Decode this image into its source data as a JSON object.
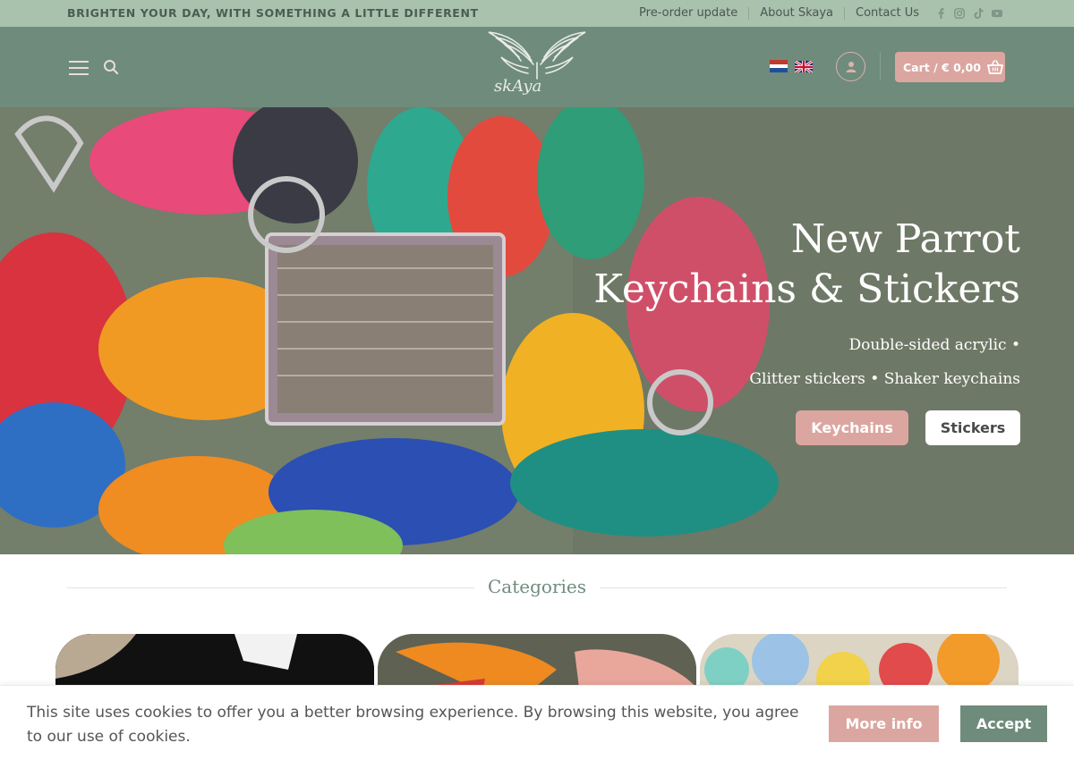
{
  "topbar": {
    "tagline": "BRIGHTEN YOUR DAY, WITH SOMETHING A LITTLE DIFFERENT",
    "links": [
      "Pre-order update",
      "About Skaya",
      "Contact Us"
    ],
    "social_icons": [
      "facebook-icon",
      "instagram-icon",
      "tiktok-icon",
      "youtube-icon"
    ]
  },
  "header": {
    "logo_text": "skAya",
    "languages": [
      "Dutch",
      "English"
    ],
    "cart_label": "Cart / € 0,00"
  },
  "hero": {
    "title_line1": "New Parrot",
    "title_line2": "Keychains & Stickers",
    "subtitle_line1": "Double-sided acrylic •",
    "subtitle_line2": "Glitter stickers • Shaker keychains",
    "button_primary": "Keychains",
    "button_secondary": "Stickers"
  },
  "categories": {
    "title": "Categories"
  },
  "cookie": {
    "text": "This site uses cookies to offer you a better browsing experience. By browsing this website, you agree to our use of cookies.",
    "more_info": "More info",
    "accept": "Accept"
  },
  "colors": {
    "sage": "#6f8b7c",
    "topbar": "#a9c2ad",
    "pink": "#dca6a0"
  }
}
